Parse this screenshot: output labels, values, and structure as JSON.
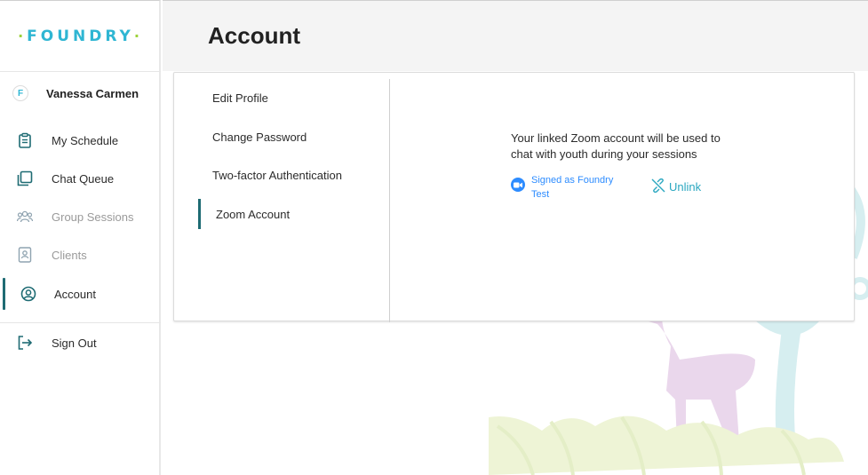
{
  "brand": {
    "logo": "FOUNDRY",
    "badge_letter": "F"
  },
  "user": {
    "name": "Vanessa Carmen"
  },
  "nav": {
    "items": [
      {
        "label": "My Schedule",
        "icon": "clipboard-icon",
        "state": "normal"
      },
      {
        "label": "Chat Queue",
        "icon": "chat-queue-icon",
        "state": "normal"
      },
      {
        "label": "Group Sessions",
        "icon": "group-icon",
        "state": "disabled"
      },
      {
        "label": "Clients",
        "icon": "contact-card-icon",
        "state": "disabled"
      },
      {
        "label": "Account",
        "icon": "account-circle-icon",
        "state": "active"
      }
    ],
    "sign_out": {
      "label": "Sign Out",
      "icon": "sign-out-icon"
    }
  },
  "page": {
    "title": "Account"
  },
  "account_menu": {
    "items": [
      {
        "label": "Edit Profile"
      },
      {
        "label": "Change Password"
      },
      {
        "label": "Two-factor Authentication"
      },
      {
        "label": "Zoom Account",
        "active": true
      }
    ]
  },
  "zoom": {
    "description": "Your linked Zoom account will be used to chat with youth during your sessions",
    "signed_as": "Signed as Foundry Test",
    "unlink_label": "Unlink"
  },
  "colors": {
    "accent": "#1e6b73",
    "brand": "#2fb6d3",
    "zoom_blue": "#2d8cff",
    "link": "#2aa7c0"
  }
}
